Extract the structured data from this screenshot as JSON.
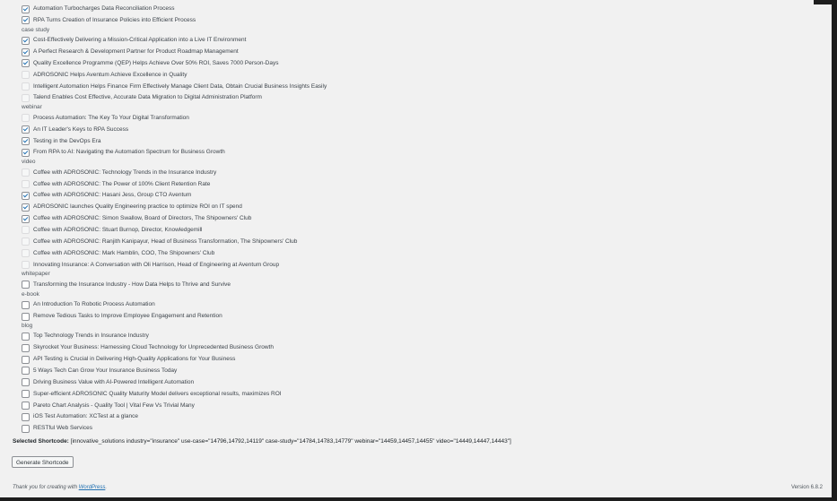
{
  "groups": [
    {
      "category": "",
      "items": [
        {
          "label": "Automation Turbocharges Data Reconciliation Process",
          "checked": true
        },
        {
          "label": "RPA Turns Creation of Insurance Policies into Efficient Process",
          "checked": true
        }
      ]
    },
    {
      "category": "case study",
      "items": [
        {
          "label": "Cost-Effectively Delivering a Mission-Critical Application into a Live IT Environment",
          "checked": true
        },
        {
          "label": "A Perfect Research & Development Partner for Product Roadmap Management",
          "checked": true
        },
        {
          "label": "Quality Excellence Programme (QEP) Helps Achieve Over 50% ROI, Saves 7000 Person-Days",
          "checked": true
        },
        {
          "label": "ADROSONIC Helps Aventum Achieve Excellence in Quality",
          "checked": false
        },
        {
          "label": "Intelligent Automation Helps Finance Firm Effectively Manage Client Data, Obtain Crucial Business Insights Easily",
          "checked": false
        },
        {
          "label": "Talend Enables Cost Effective, Accurate Data Migration to Digital Administration Platform",
          "checked": false
        }
      ]
    },
    {
      "category": "webinar",
      "items": [
        {
          "label": "Process Automation: The Key To Your Digital Transformation",
          "checked": false
        },
        {
          "label": "An IT Leader's Keys to RPA Success",
          "checked": true
        },
        {
          "label": "Testing in the DevOps Era",
          "checked": true
        },
        {
          "label": "From RPA to AI: Navigating the Automation Spectrum for Business Growth",
          "checked": true
        }
      ]
    },
    {
      "category": "video",
      "items": [
        {
          "label": "Coffee with ADROSONIC: Technology Trends in the Insurance Industry",
          "checked": false
        },
        {
          "label": "Coffee with ADROSONIC: The Power of 100% Client Retention Rate",
          "checked": false
        },
        {
          "label": "Coffee with ADROSONIC: Hasani Jess, Group CTO Aventum",
          "checked": true
        },
        {
          "label": "ADROSONIC launches Quality Engineering practice to optimize ROI on IT spend",
          "checked": true
        },
        {
          "label": "Coffee with ADROSONIC: Simon Swallow, Board of Directors, The Shipowners' Club",
          "checked": true
        },
        {
          "label": "Coffee with ADROSONIC: Stuart Burnop, Director, Knowledgemill",
          "checked": false
        },
        {
          "label": "Coffee with ADROSONIC: Ranjith Kanipayur, Head of Business Transformation, The Shipowners' Club",
          "checked": false
        },
        {
          "label": "Coffee with ADROSONIC: Mark Hamblin, COO, The Shipowners' Club",
          "checked": false
        },
        {
          "label": "Innovating Insurance: A Conversation with Oli Harrison, Head of Engineering at Aventum Group",
          "checked": false
        }
      ]
    },
    {
      "category": "whitepaper",
      "items": [
        {
          "label": "Transforming the Insurance Industry - How Data Helps to Thrive and Survive",
          "checked": false
        }
      ]
    },
    {
      "category": "e-book",
      "items": [
        {
          "label": "An Introduction To Robotic Process Automation",
          "checked": false
        },
        {
          "label": "Remove Tedious Tasks to Improve Employee Engagement and Retention",
          "checked": false
        }
      ]
    },
    {
      "category": "blog",
      "items": [
        {
          "label": "Top Technology Trends in Insurance Industry",
          "checked": false
        },
        {
          "label": "Skyrocket Your Business: Harnessing Cloud Technology for Unprecedented Business Growth",
          "checked": false
        },
        {
          "label": "API Testing is Crucial in Delivering High-Quality Applications for Your Business",
          "checked": false
        },
        {
          "label": "5 Ways Tech Can Grow Your Insurance Business Today",
          "checked": false
        },
        {
          "label": "Driving Business Value with AI-Powered Intelligent Automation",
          "checked": false
        },
        {
          "label": "Super-efficient ADROSONIC Quality Maturity Model delivers exceptional results, maximizes ROI",
          "checked": false
        },
        {
          "label": "Pareto Chart Analysis - Quality Tool | Vital Few Vs Trivial Many",
          "checked": false
        },
        {
          "label": "iOS Test Automation: XCTest at a glance",
          "checked": false
        },
        {
          "label": "RESTful Web Services",
          "checked": false
        }
      ]
    }
  ],
  "shortcode": {
    "label": "Selected Shortcode:",
    "value": "[innovative_solutions industry=\"insurance\" use-case=\"14796,14792,14119\" case-study=\"14784,14783,14779\" webinar=\"14459,14457,14455\" video=\"14449,14447,14443\"]"
  },
  "generate_button": "Generate Shortcode",
  "footer": {
    "thanks_prefix": "Thank you for creating with ",
    "thanks_link": "WordPress",
    "thanks_suffix": ".",
    "version": "Version 6.8.2"
  }
}
